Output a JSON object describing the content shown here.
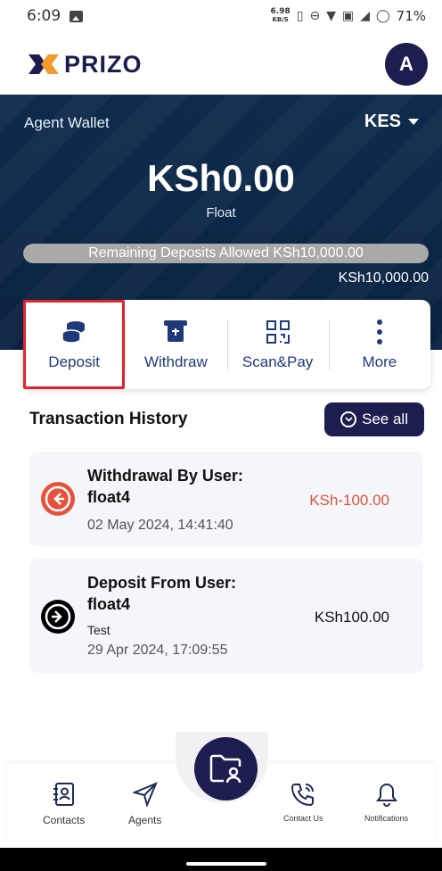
{
  "status_bar": {
    "time": "6:09",
    "net_speed": "6.98",
    "net_unit": "KB/S",
    "battery": "71%"
  },
  "app": {
    "brand": "PRIZO",
    "avatar_initial": "A"
  },
  "wallet": {
    "label": "Agent Wallet",
    "currency": "KES",
    "balance": "KSh0.00",
    "balance_caption": "Float",
    "remaining_text": "Remaining Deposits Allowed KSh10,000.00",
    "remaining_progress": 1.0,
    "limit": "KSh10,000.00"
  },
  "actions": [
    {
      "label": "Deposit",
      "icon": "coins-icon"
    },
    {
      "label": "Withdraw",
      "icon": "atm-withdraw-icon"
    },
    {
      "label": "Scan&Pay",
      "icon": "qr-code-icon"
    },
    {
      "label": "More",
      "icon": "more-vertical-icon"
    }
  ],
  "history": {
    "title": "Transaction History",
    "see_all": "See all",
    "items": [
      {
        "title_line1": "Withdrawal By User:",
        "title_line2": "float4",
        "note": "",
        "date": "02 May 2024, 14:41:40",
        "amount": "KSh-100.00",
        "direction": "out"
      },
      {
        "title_line1": "Deposit From User:",
        "title_line2": "float4",
        "note": "Test",
        "date": "29 Apr 2024, 17:09:55",
        "amount": "KSh100.00",
        "direction": "in"
      }
    ]
  },
  "nav": [
    {
      "label": "Contacts",
      "icon": "contacts-icon"
    },
    {
      "label": "Agents",
      "icon": "send-icon"
    },
    {
      "label": "Contact Us",
      "icon": "phone-icon"
    },
    {
      "label": "Notifications",
      "icon": "bell-icon"
    }
  ],
  "colors": {
    "navy": "#1d1d4f",
    "wallet_bg": "#0f2b4c",
    "negative": "#d9533b",
    "highlight": "#e3242b",
    "action_text": "#1e3a7a"
  }
}
